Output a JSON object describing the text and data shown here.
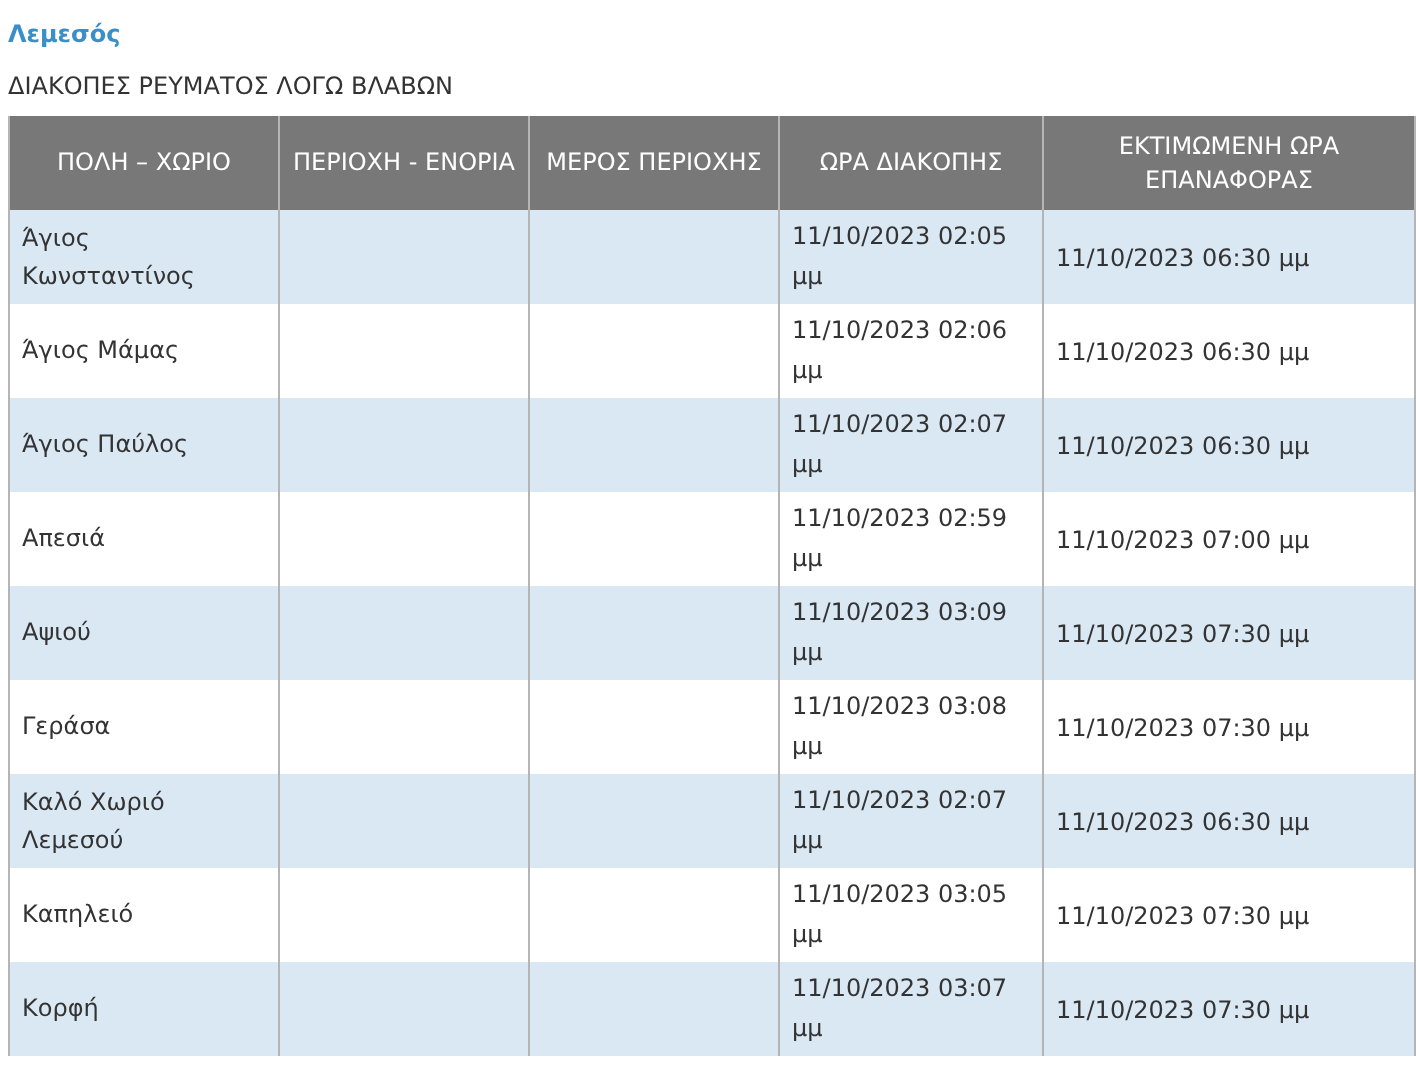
{
  "region_title": "Λεμεσός",
  "heading": "ΔΙΑΚΟΠΕΣ ΡΕΥΜΑΤΟΣ ΛΟΓΩ ΒΛΑΒΩΝ",
  "table": {
    "columns": [
      "ΠΟΛΗ – ΧΩΡΙΟ",
      "ΠΕΡΙΟΧΗ - ΕΝΟΡΙΑ",
      "ΜΕΡΟΣ ΠΕΡΙΟΧΗΣ",
      "ΩΡΑ ΔΙΑΚΟΠΗΣ",
      "ΕΚΤΙΜΩΜΕΝΗ ΩΡΑ ΕΠΑΝΑΦΟΡΑΣ"
    ],
    "rows": [
      {
        "town": "Άγιος Κωνσταντίνος",
        "outage_time": "11/10/2023 02:05 μμ",
        "restoration_time": "11/10/2023 06:30 μμ"
      },
      {
        "town": "Άγιος Μάμας",
        "outage_time": "11/10/2023 02:06 μμ",
        "restoration_time": "11/10/2023 06:30 μμ"
      },
      {
        "town": "Άγιος Παύλος",
        "outage_time": "11/10/2023 02:07 μμ",
        "restoration_time": "11/10/2023 06:30 μμ"
      },
      {
        "town": "Απεσιά",
        "outage_time": "11/10/2023 02:59 μμ",
        "restoration_time": "11/10/2023 07:00 μμ"
      },
      {
        "town": "Αψιού",
        "outage_time": "11/10/2023 03:09 μμ",
        "restoration_time": "11/10/2023 07:30 μμ"
      },
      {
        "town": "Γεράσα",
        "outage_time": "11/10/2023 03:08 μμ",
        "restoration_time": "11/10/2023 07:30 μμ"
      },
      {
        "town": "Καλό Χωριό Λεμεσού",
        "outage_time": "11/10/2023 02:07 μμ",
        "restoration_time": "11/10/2023 06:30 μμ"
      },
      {
        "town": "Καπηλειό",
        "outage_time": "11/10/2023 03:05 μμ",
        "restoration_time": "11/10/2023 07:30 μμ"
      },
      {
        "town": "Κορφή",
        "outage_time": "11/10/2023 03:07 μμ",
        "restoration_time": "11/10/2023 07:30 μμ"
      }
    ]
  }
}
